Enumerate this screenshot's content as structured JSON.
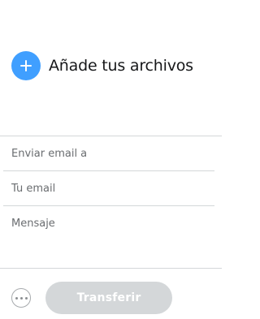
{
  "upload": {
    "add_label": "Añade tus archivos",
    "icon": "plus-icon",
    "accent_color": "#409fff"
  },
  "form": {
    "recipient_placeholder": "Enviar email a",
    "sender_placeholder": "Tu email",
    "message_placeholder": "Mensaje",
    "recipient_value": "",
    "sender_value": "",
    "message_value": ""
  },
  "footer": {
    "more_icon": "more-options-icon",
    "transfer_label": "Transferir",
    "transfer_disabled_color": "#d4d7d9"
  }
}
